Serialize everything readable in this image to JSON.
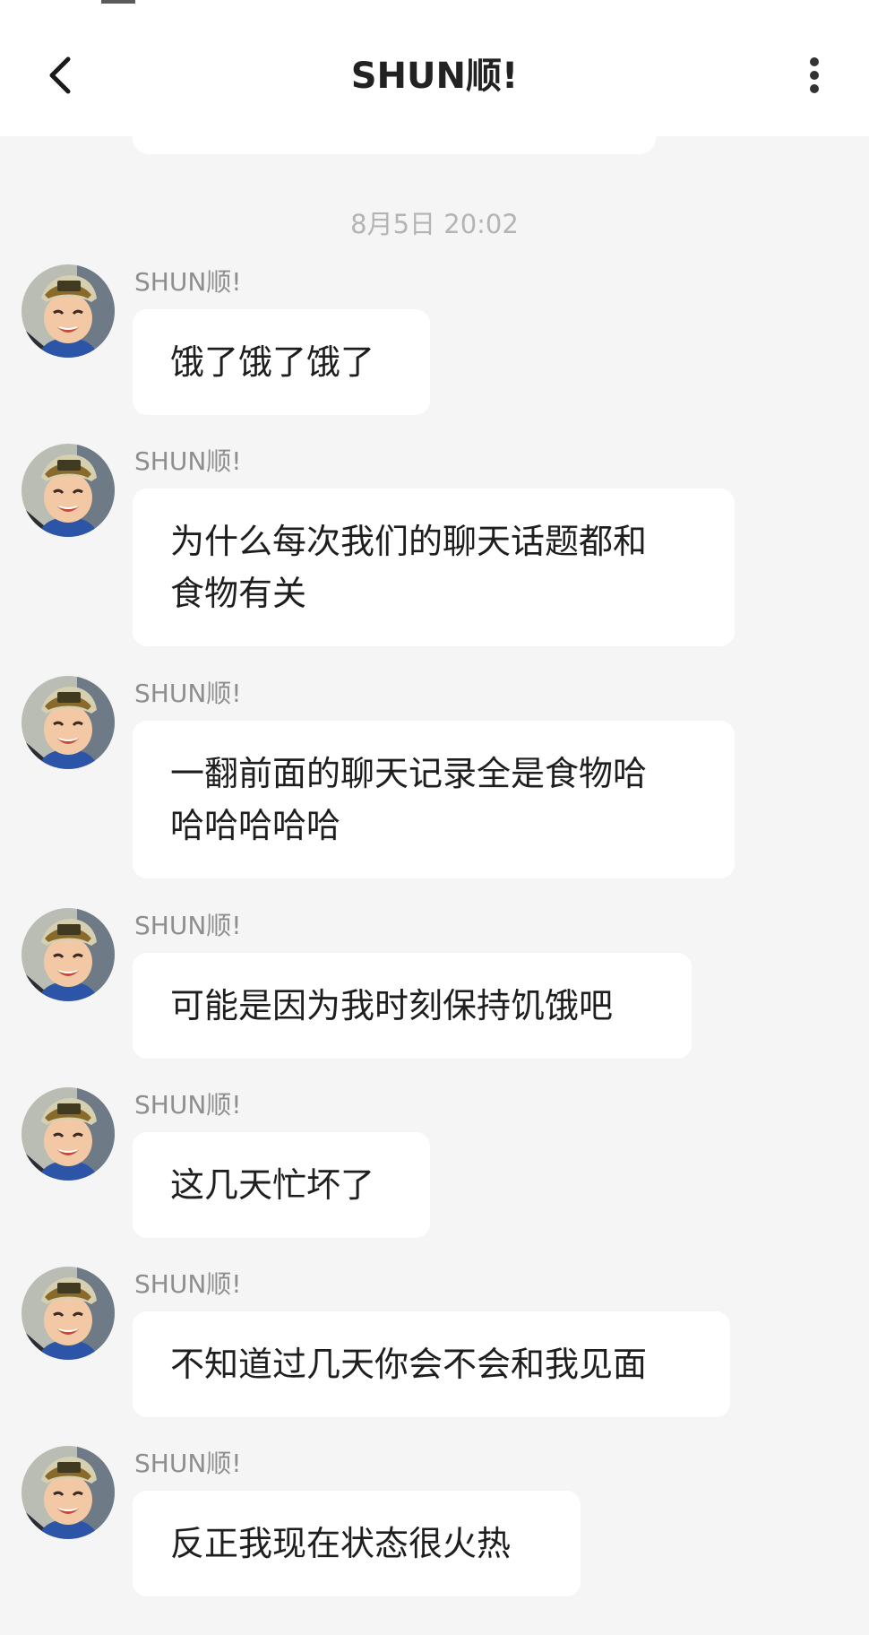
{
  "header": {
    "title": "SHUN顺!",
    "back_icon": "chevron-left-icon",
    "more_icon": "more-vertical-icon"
  },
  "chat": {
    "timestamp": "8月5日 20:02",
    "messages": [
      {
        "sender": "SHUN顺!",
        "lines": [
          "饿了饿了饿了"
        ]
      },
      {
        "sender": "SHUN顺!",
        "lines": [
          "为什么每次我们的聊天话题都和",
          "食物有关"
        ]
      },
      {
        "sender": "SHUN顺!",
        "lines": [
          "一翻前面的聊天记录全是食物哈",
          "哈哈哈哈哈"
        ]
      },
      {
        "sender": "SHUN顺!",
        "lines": [
          "可能是因为我时刻保持饥饿吧"
        ]
      },
      {
        "sender": "SHUN顺!",
        "lines": [
          "这几天忙坏了"
        ]
      },
      {
        "sender": "SHUN顺!",
        "lines": [
          "不知道过几天你会不会和我见面"
        ]
      },
      {
        "sender": "SHUN顺!",
        "lines": [
          "反正我现在状态很火热"
        ]
      }
    ]
  },
  "colors": {
    "background": "#f5f5f5",
    "bubble": "#ffffff",
    "header": "#ffffff"
  }
}
